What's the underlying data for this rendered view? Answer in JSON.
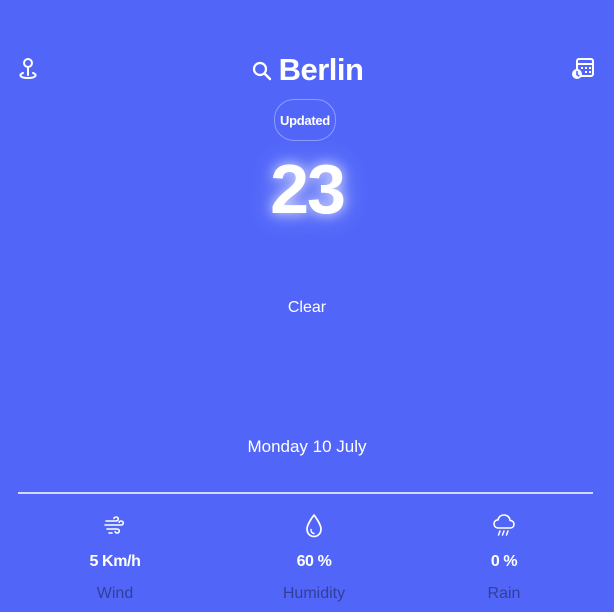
{
  "header": {
    "city": "Berlin",
    "updated_label": "Updated"
  },
  "current": {
    "temperature": "23",
    "condition": "Clear",
    "date": "Monday 10 July"
  },
  "stats": [
    {
      "icon": "wind-icon",
      "value": "5 Km/h",
      "label": "Wind"
    },
    {
      "icon": "droplet-icon",
      "value": "60 %",
      "label": "Humidity"
    },
    {
      "icon": "rain-cloud-icon",
      "value": "0 %",
      "label": "Rain"
    }
  ],
  "colors": {
    "background": "#5166f9",
    "text": "#ffffff",
    "label": "#283278"
  },
  "icons": {
    "location": "location-pin-icon",
    "search": "search-icon",
    "calendar": "calendar-icon"
  }
}
